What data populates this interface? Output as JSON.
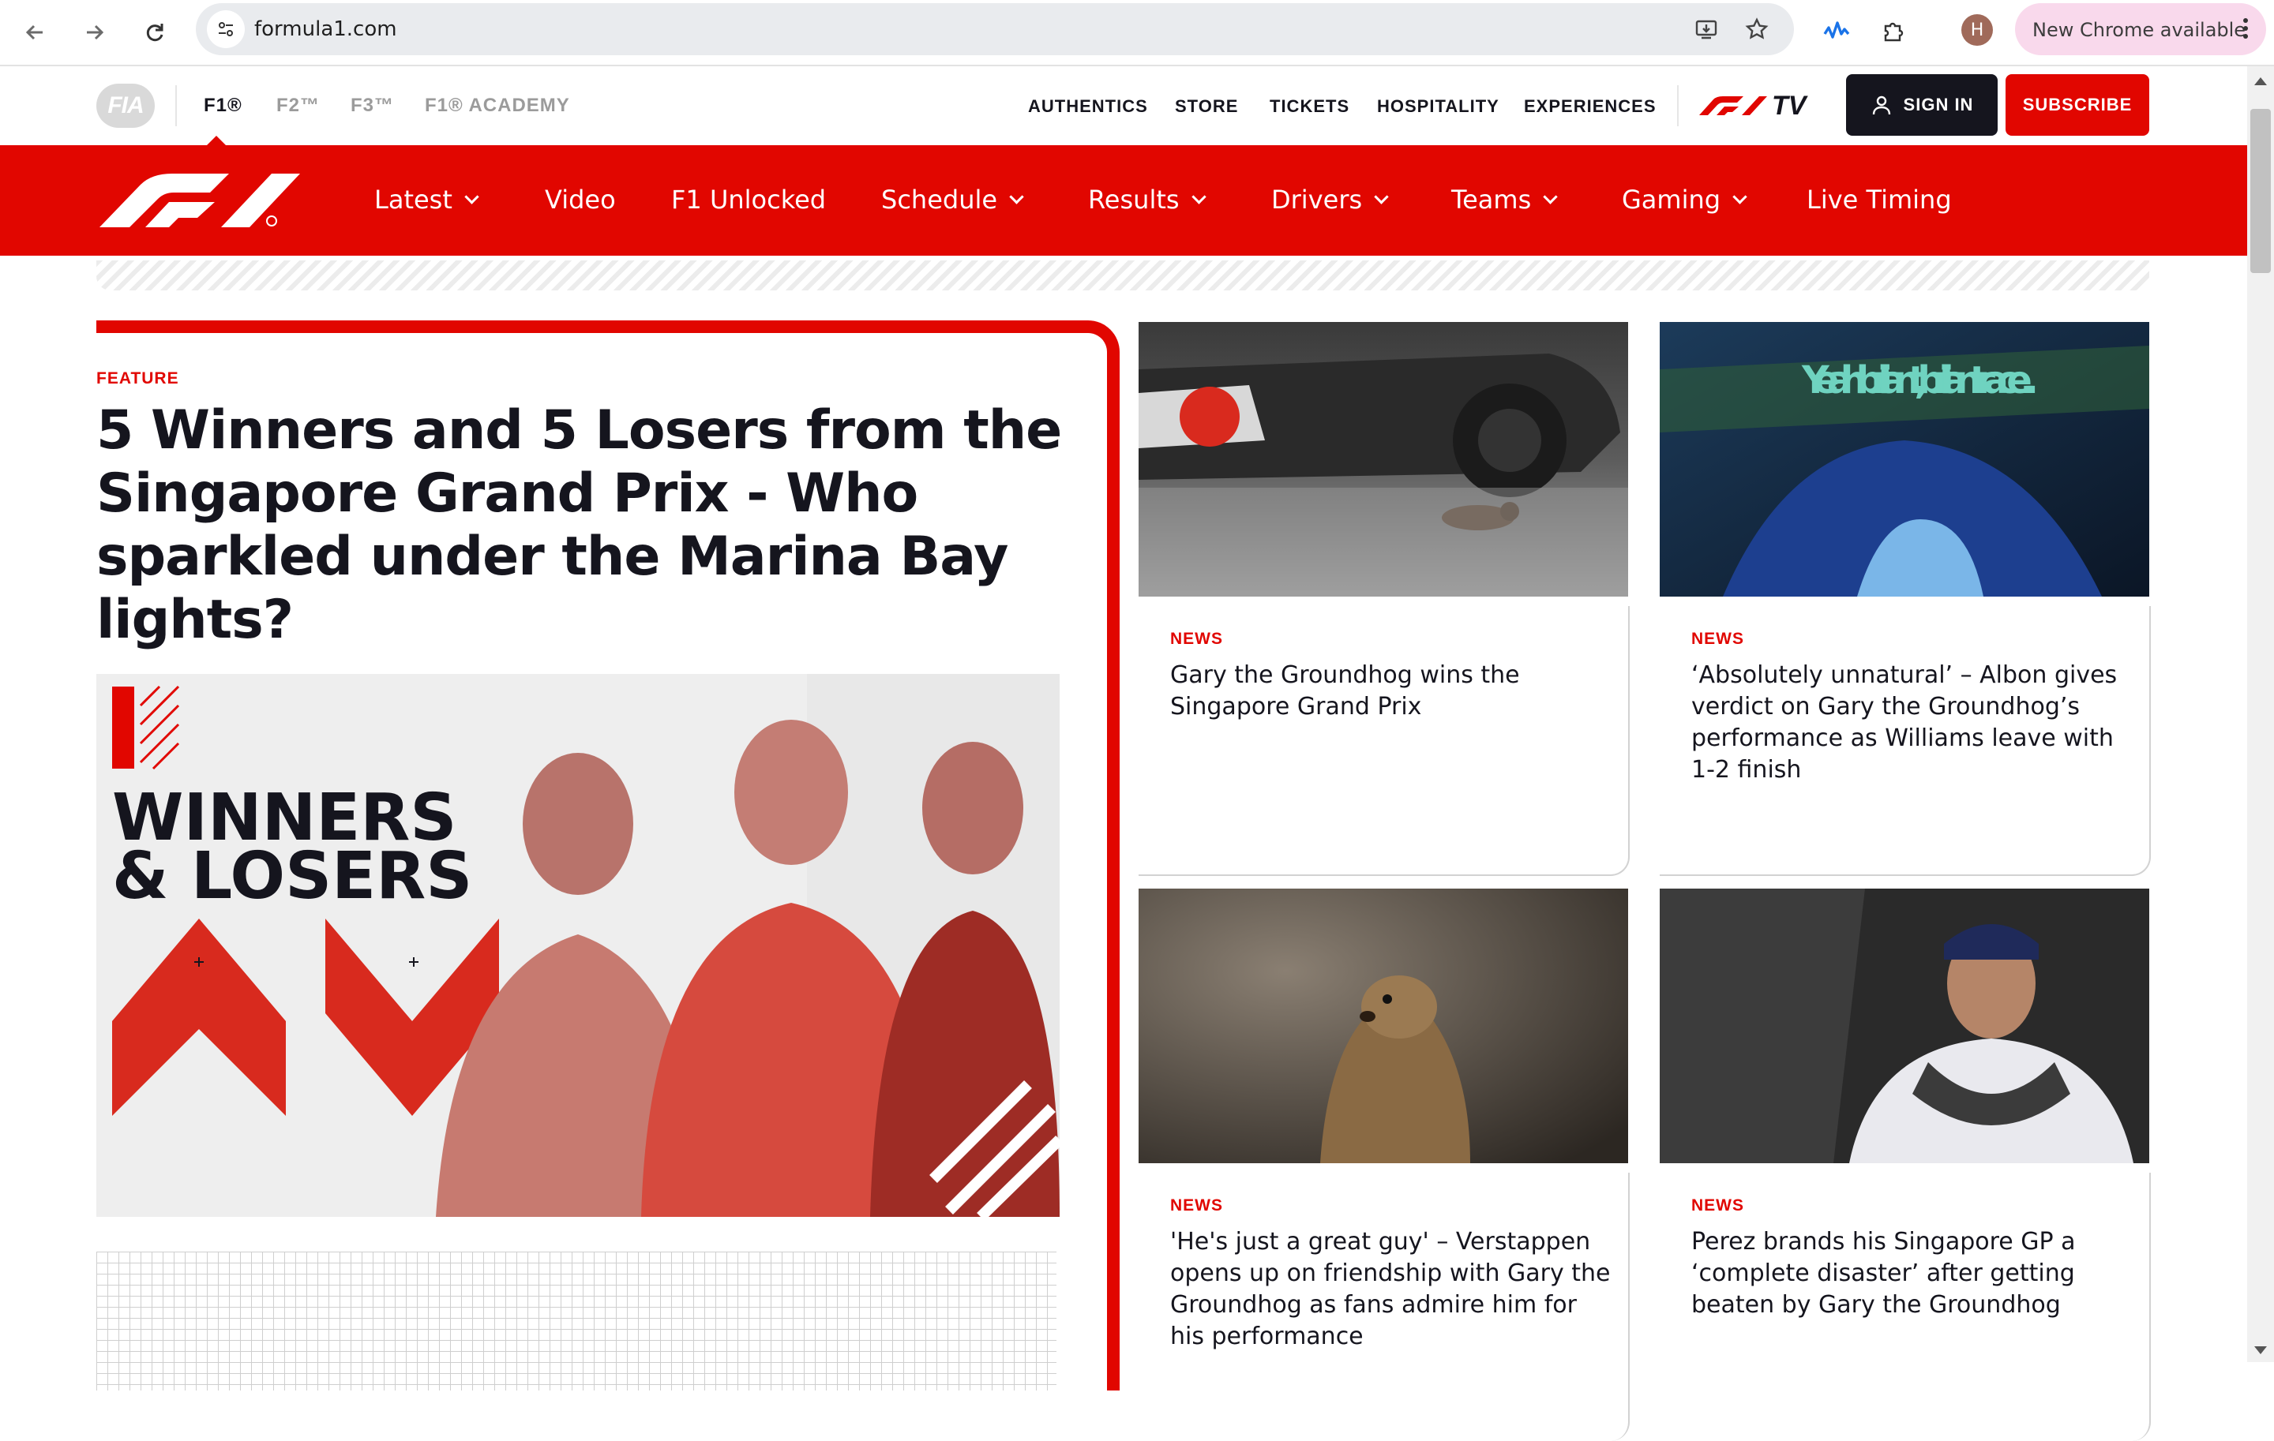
{
  "browser": {
    "url": "formula1.com",
    "new_chrome_label": "New Chrome available",
    "profile_initial": "H"
  },
  "series_nav": {
    "fia_logo": "FIA",
    "items": [
      {
        "label": "F1®"
      },
      {
        "label": "F2™"
      },
      {
        "label": "F3™"
      },
      {
        "label": "F1® ACADEMY"
      }
    ]
  },
  "utility_nav": {
    "links": [
      "AUTHENTICS",
      "STORE",
      "TICKETS",
      "HOSPITALITY",
      "EXPERIENCES"
    ],
    "f1tv_label": "TV",
    "signin_label": "SIGN IN",
    "subscribe_label": "SUBSCRIBE"
  },
  "main_nav": {
    "items": [
      {
        "label": "Latest",
        "dropdown": true
      },
      {
        "label": "Video",
        "dropdown": false
      },
      {
        "label": "F1 Unlocked",
        "dropdown": false
      },
      {
        "label": "Schedule",
        "dropdown": true
      },
      {
        "label": "Results",
        "dropdown": true
      },
      {
        "label": "Drivers",
        "dropdown": true
      },
      {
        "label": "Teams",
        "dropdown": true
      },
      {
        "label": "Gaming",
        "dropdown": true
      },
      {
        "label": "Live Timing",
        "dropdown": false
      }
    ]
  },
  "feature": {
    "kicker": "FEATURE",
    "title": "5 Winners and 5 Losers from the Singapore Grand Prix - Who sparkled under the Marina Bay lights?",
    "image_text_line1": "WINNERS",
    "image_text_line2": "& LOSERS"
  },
  "news": [
    {
      "kicker": "NEWS",
      "headline": "Gary the Groundhog wins the Singapore Grand Prix"
    },
    {
      "kicker": "NEWS",
      "headline": "‘Absolutely unnatural’ – Albon gives verdict on Gary the Groundhog’s performance as Williams leave with 1-2 finish",
      "overlay_text": "Yeah brilliant, brilliant race..."
    },
    {
      "kicker": "NEWS",
      "headline": "'He's just a great guy' – Verstappen opens up on friendship with Gary the Groundhog as fans admire him for his performance"
    },
    {
      "kicker": "NEWS",
      "headline": "Perez brands his Singapore GP a ‘complete disaster’ after getting beaten by Gary the Groundhog"
    }
  ],
  "colors": {
    "brand_red": "#e10600",
    "carbon": "#15151e"
  }
}
